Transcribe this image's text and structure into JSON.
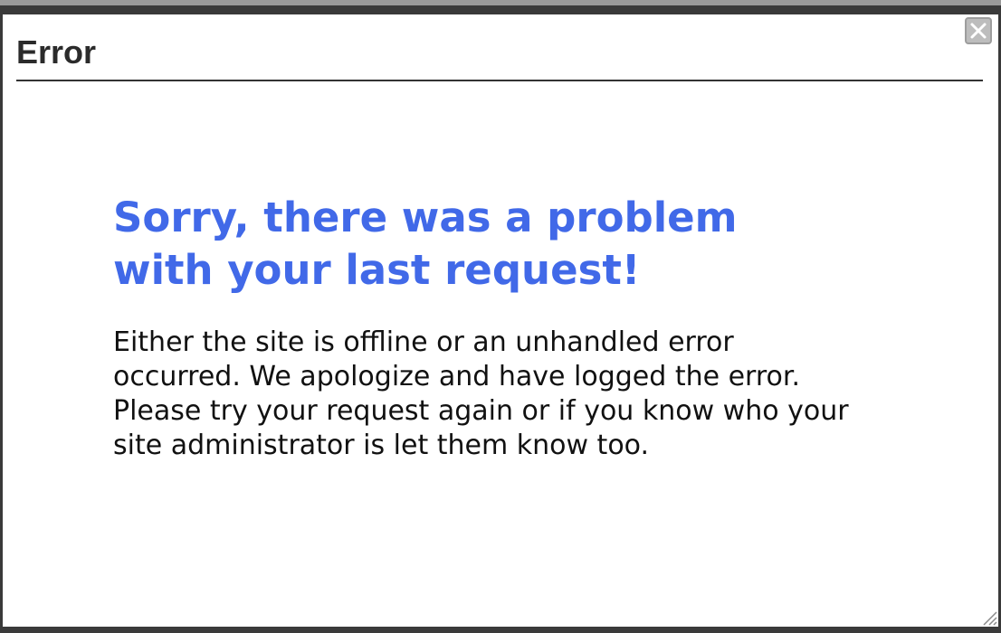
{
  "dialog": {
    "title": "Error",
    "close_icon": "close-icon",
    "resize_icon": "resize-grip-icon"
  },
  "content": {
    "heading": "Sorry, there was a problem with your last request!",
    "message": "Either the site is offline or an unhandled error occurred. We apologize and have logged the error. Please try your request again or if you know who your site administrator is let them know too."
  },
  "colors": {
    "heading": "#4169e8",
    "frame": "#3a3a3a",
    "title": "#2b2b2b"
  }
}
